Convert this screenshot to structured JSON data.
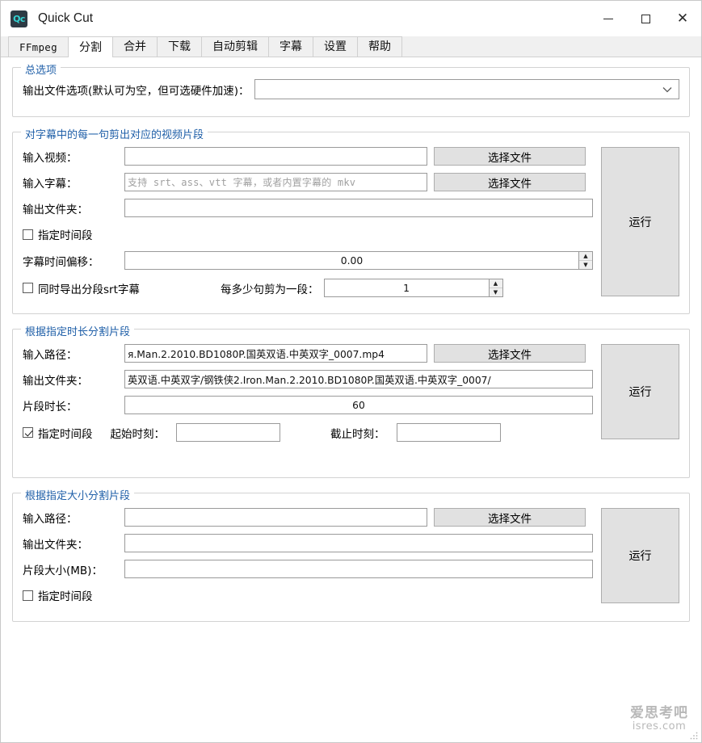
{
  "window": {
    "title": "Quick Cut",
    "icon_label": "Qc",
    "icon_name": "app-icon-quickcut",
    "minimize_glyph": "—",
    "maximize_glyph": "□",
    "close_glyph": "✕"
  },
  "tabs": [
    {
      "label": "FFmpeg",
      "active": false,
      "mono": true
    },
    {
      "label": "分割",
      "active": true,
      "mono": false
    },
    {
      "label": "合并",
      "active": false,
      "mono": false
    },
    {
      "label": "下载",
      "active": false,
      "mono": false
    },
    {
      "label": "自动剪辑",
      "active": false,
      "mono": false
    },
    {
      "label": "字幕",
      "active": false,
      "mono": false
    },
    {
      "label": "设置",
      "active": false,
      "mono": false
    },
    {
      "label": "帮助",
      "active": false,
      "mono": false
    }
  ],
  "group_general": {
    "title": "总选项",
    "output_options_label": "输出文件选项(默认可为空，但可选硬件加速)：",
    "output_options_value": "",
    "dropdown_arrow": "⌄"
  },
  "group_subtitle_cut": {
    "title": "对字幕中的每一句剪出对应的视频片段",
    "input_video_label": "输入视频：",
    "input_video_value": "",
    "input_video_browse": "选择文件",
    "input_subtitle_label": "输入字幕：",
    "input_subtitle_value": "",
    "input_subtitle_placeholder": "支持 srt、ass、vtt 字幕，或者内置字幕的 mkv",
    "input_subtitle_browse": "选择文件",
    "output_folder_label": "输出文件夹：",
    "output_folder_value": "",
    "time_range_checkbox_label": "指定时间段",
    "time_range_checked": false,
    "subtitle_offset_label": "字幕时间偏移：",
    "subtitle_offset_value": "0.00",
    "export_srt_checkbox_label": "同时导出分段srt字幕",
    "export_srt_checked": false,
    "lines_per_segment_label": "每多少句剪为一段：",
    "lines_per_segment_value": "1",
    "run_label": "运行"
  },
  "group_duration_split": {
    "title": "根据指定时长分割片段",
    "input_path_label": "输入路径：",
    "input_path_value": "я.Man.2.2010.BD1080P.国英双语.中英双字_0007.mp4",
    "input_path_browse": "选择文件",
    "output_folder_label": "输出文件夹：",
    "output_folder_value": "英双语.中英双字/钢铁侠2.Iron.Man.2.2010.BD1080P.国英双语.中英双字_0007/",
    "segment_duration_label": "片段时长：",
    "segment_duration_value": "60",
    "time_range_checkbox_label": "指定时间段",
    "time_range_checked": true,
    "start_time_label": "起始时刻：",
    "start_time_value": "",
    "end_time_label": "截止时刻：",
    "end_time_value": "",
    "run_label": "运行"
  },
  "group_size_split": {
    "title": "根据指定大小分割片段",
    "input_path_label": "输入路径：",
    "input_path_value": "",
    "input_path_browse": "选择文件",
    "output_folder_label": "输出文件夹：",
    "output_folder_value": "",
    "segment_size_label": "片段大小(MB)：",
    "segment_size_value": "",
    "time_range_checkbox_label": "指定时间段",
    "time_range_checked": false,
    "run_label": "运行"
  },
  "watermark": {
    "main": "爱思考吧",
    "sub": "isres.com"
  },
  "spinner": {
    "up": "▲",
    "down": "▼"
  }
}
